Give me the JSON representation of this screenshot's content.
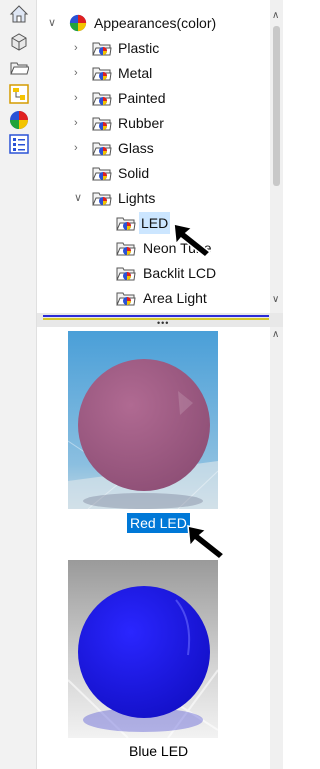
{
  "toolbar": {
    "icons": [
      "home-icon",
      "parts-icon",
      "folder-icon",
      "property-icon",
      "appearances-icon",
      "list-icon"
    ]
  },
  "tree": {
    "root": "Appearances(color)",
    "items": [
      {
        "label": "Plastic"
      },
      {
        "label": "Metal"
      },
      {
        "label": "Painted"
      },
      {
        "label": "Rubber"
      },
      {
        "label": "Glass"
      },
      {
        "label": "Solid"
      },
      {
        "label": "Lights"
      }
    ],
    "lights_children": [
      {
        "label": "LED"
      },
      {
        "label": "Neon Tube"
      },
      {
        "label": "Backlit LCD"
      },
      {
        "label": "Area Light"
      }
    ]
  },
  "preview": {
    "items": [
      {
        "label": "Red LED",
        "color": "#a05a86"
      },
      {
        "label": "Blue LED",
        "color": "#1a17e6"
      }
    ]
  },
  "colors": {
    "selection": "#0078d7",
    "tree_selection": "#cce6ff",
    "divider_blue": "#2b2bd6",
    "divider_yellow": "#d6c72b"
  }
}
